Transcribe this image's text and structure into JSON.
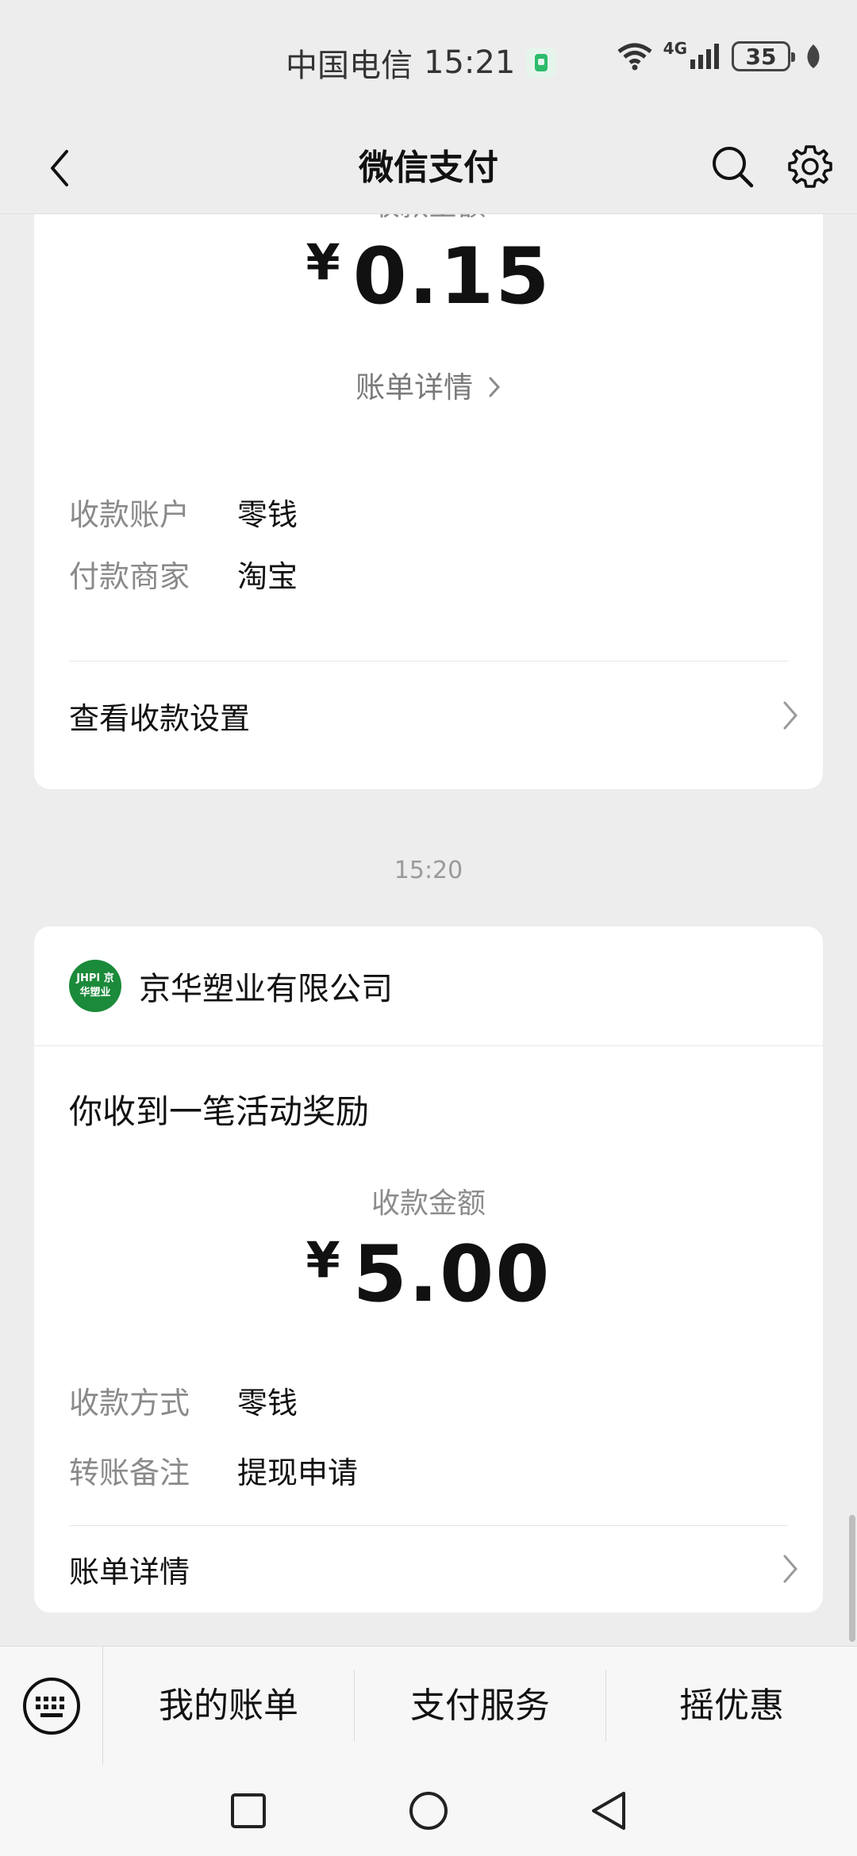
{
  "status_bar": {
    "carrier": "中国电信",
    "time": "15:21",
    "network": "4G",
    "battery": "35"
  },
  "nav": {
    "title": "微信支付"
  },
  "card1": {
    "amount_label": "收款金额",
    "currency": "¥",
    "amount": "0.15",
    "bill_link": "账单详情",
    "rows": [
      {
        "key": "收款账户",
        "value": "零钱"
      },
      {
        "key": "付款商家",
        "value": "淘宝"
      }
    ],
    "footer": "查看收款设置"
  },
  "timestamp": "15:20",
  "card2": {
    "merchant_logo_text": "JHPI 京华塑业",
    "merchant_name": "京华塑业有限公司",
    "headline": "你收到一笔活动奖励",
    "amount_label": "收款金额",
    "currency": "¥",
    "amount": "5.00",
    "rows": [
      {
        "key": "收款方式",
        "value": "零钱"
      },
      {
        "key": "转账备注",
        "value": "提现申请"
      }
    ],
    "footer": "账单详情"
  },
  "bottom_menu": {
    "items": [
      "我的账单",
      "支付服务",
      "摇优惠"
    ]
  },
  "colors": {
    "background": "#ededed",
    "card": "#ffffff",
    "merchant_green": "#1b8a3a"
  }
}
